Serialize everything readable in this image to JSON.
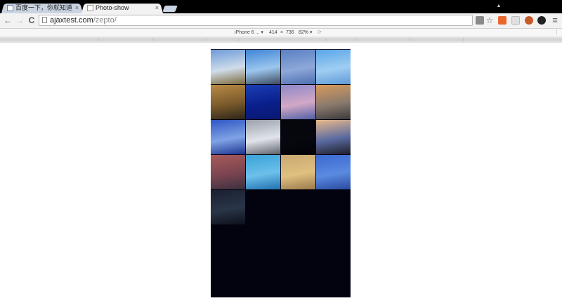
{
  "browser": {
    "tabs": [
      {
        "label": "百度一下，你就知道",
        "active": false,
        "icon": "baidu-favicon-icon"
      },
      {
        "label": "Photo-show",
        "active": true,
        "icon": "page-icon"
      }
    ],
    "tab_close_glyph": "×",
    "user_glyph": "▲"
  },
  "toolbar": {
    "back_glyph": "←",
    "forward_glyph": "→",
    "reload_glyph": "C",
    "url_host": "ajaxtest.com",
    "url_path": "/zepto/",
    "menu_glyph": "≡"
  },
  "device_toolbar": {
    "device": "iPhone 6 ...",
    "width": "414",
    "times": "×",
    "height": "736",
    "zoom": "82%",
    "dropdown_glyph": "▾",
    "rotate_glyph": "⟳",
    "more_glyph": "⋮"
  },
  "gallery": {
    "photos": [
      {
        "name": "sky-clouds-photo",
        "colors": [
          "#6d9bd8",
          "#cfdcea",
          "#7c6a3c"
        ]
      },
      {
        "name": "horizon-photo",
        "colors": [
          "#3f85d6",
          "#9cc6ee",
          "#3d4a5e"
        ]
      },
      {
        "name": "windmill-photo",
        "colors": [
          "#5a7fc2",
          "#8da8d9",
          "#4e6eb0"
        ]
      },
      {
        "name": "clear-sky-photo",
        "colors": [
          "#5aa6e8",
          "#9fcdf2",
          "#5f9ad6"
        ]
      },
      {
        "name": "bare-tree-photo",
        "colors": [
          "#b98a45",
          "#7a5a2c",
          "#2c2418"
        ]
      },
      {
        "name": "deep-blue-photo",
        "colors": [
          "#1b3fb5",
          "#0a1f8c",
          "#0a1870"
        ]
      },
      {
        "name": "purple-clouds-photo",
        "colors": [
          "#8c88c9",
          "#d3a8c6",
          "#4f5fa6"
        ]
      },
      {
        "name": "sunset-field-photo",
        "colors": [
          "#d89a5a",
          "#8a7a6e",
          "#3a3a3a"
        ]
      },
      {
        "name": "blue-haze-photo",
        "colors": [
          "#2f56c4",
          "#7fa3e4",
          "#1c3490"
        ]
      },
      {
        "name": "grey-sky-photo",
        "colors": [
          "#9aa0aa",
          "#e1e4ea",
          "#5d616a"
        ]
      },
      {
        "name": "night-photo",
        "colors": [
          "#05050c",
          "#07070f",
          "#020207"
        ]
      },
      {
        "name": "tree-silhouette-photo",
        "colors": [
          "#e8b98a",
          "#5a6aa0",
          "#1e1e2a"
        ]
      },
      {
        "name": "red-dusk-photo",
        "colors": [
          "#a85a5a",
          "#7a4450",
          "#3a3040"
        ]
      },
      {
        "name": "cyan-water-photo",
        "colors": [
          "#3aa2d8",
          "#6cc0ea",
          "#2070b0"
        ]
      },
      {
        "name": "golden-clouds-photo",
        "colors": [
          "#c8a870",
          "#e0c080",
          "#9a7a4a"
        ]
      },
      {
        "name": "blue-sea-photo",
        "colors": [
          "#3a6ad0",
          "#5a8ae0",
          "#2a4aa0"
        ]
      },
      {
        "name": "dark-landscape-photo",
        "colors": [
          "#1a2030",
          "#2a3548",
          "#0c101a"
        ]
      }
    ]
  },
  "colors": {
    "titlebar": "#000000",
    "viewport_bg": "#03030f"
  }
}
